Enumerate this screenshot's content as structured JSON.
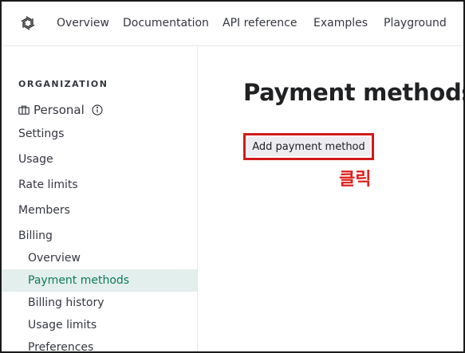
{
  "topnav": {
    "logo": "openai-logo-icon",
    "items": [
      "Overview",
      "Documentation",
      "API reference",
      "Examples",
      "Playground"
    ]
  },
  "sidebar": {
    "section_title": "ORGANIZATION",
    "org": {
      "label": "Personal",
      "icon": "briefcase-icon",
      "info_icon": "info-icon"
    },
    "items": [
      "Settings",
      "Usage",
      "Rate limits",
      "Members",
      "Billing"
    ],
    "billing_subitems": [
      "Overview",
      "Payment methods",
      "Billing history",
      "Usage limits",
      "Preferences"
    ],
    "active_subitem": "Payment methods"
  },
  "main": {
    "title": "Payment methods",
    "add_button_label": "Add payment method",
    "annotation": "클릭"
  },
  "colors": {
    "accent_green": "#0e7a5b",
    "active_bg": "#e3efec",
    "highlight_red": "#d11a1a"
  }
}
